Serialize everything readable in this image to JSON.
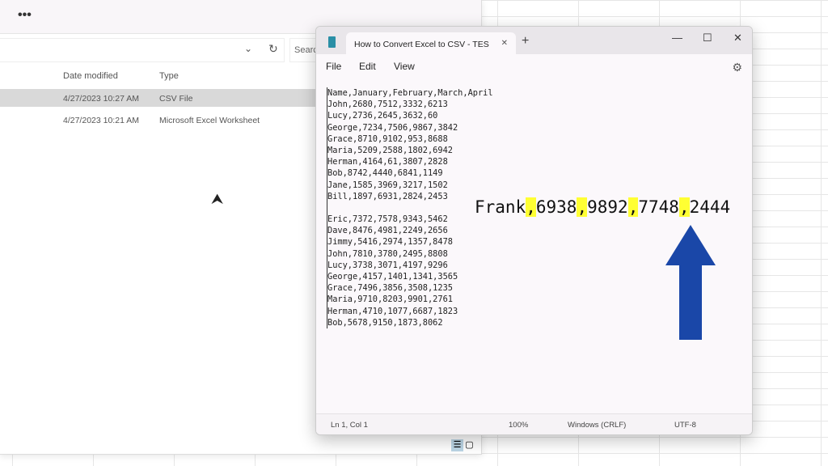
{
  "explorer": {
    "more_label": "•••",
    "search_placeholder": "Search",
    "columns": {
      "date": "Date modified",
      "type": "Type"
    },
    "files": [
      {
        "date": "4/27/2023 10:27 AM",
        "type": "CSV File"
      },
      {
        "date": "4/27/2023 10:21 AM",
        "type": "Microsoft Excel Worksheet"
      }
    ]
  },
  "notepad": {
    "tab_title": "How to Convert Excel to CSV - TES",
    "menu": [
      "File",
      "Edit",
      "View"
    ],
    "lines": [
      "Name,January,February,March,April",
      "John,2680,7512,3332,6213",
      "Lucy,2736,2645,3632,60",
      "George,7234,7506,9867,3842",
      "Grace,8710,9102,953,8688",
      "Maria,5209,2588,1802,6942",
      "Herman,4164,61,3807,2828",
      "Bob,8742,4440,6841,1149",
      "Jane,1585,3969,3217,1502",
      "Bill,1897,6931,2824,2453",
      "",
      "Eric,7372,7578,9343,5462",
      "Dave,8476,4981,2249,2656",
      "Jimmy,5416,2974,1357,8478",
      "John,7810,3780,2495,8808",
      "Lucy,3738,3071,4197,9296",
      "George,4157,1401,1341,3565",
      "Grace,7496,3856,3508,1235",
      "Maria,9710,8203,9901,2761",
      "Herman,4710,1077,6687,1823",
      "Bob,5678,9150,1873,8062"
    ],
    "status": {
      "position": "Ln 1, Col 1",
      "zoom": "100%",
      "line_ending": "Windows (CRLF)",
      "encoding": "UTF-8"
    }
  },
  "overlay": {
    "parts": [
      "Frank",
      ",",
      "6938",
      ",",
      "9892",
      ",",
      "7748",
      ",",
      "2444"
    ],
    "highlight_color": "#ffff33",
    "arrow_color": "#1a47a8"
  }
}
